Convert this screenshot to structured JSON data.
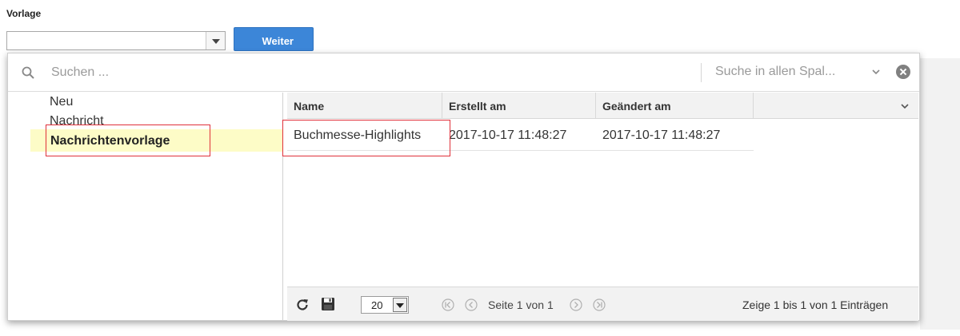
{
  "template": {
    "label": "Vorlage",
    "selected_value": "",
    "next_button": "Weiter"
  },
  "search": {
    "placeholder": "Suchen ...",
    "scope": "Suche in allen Spal..."
  },
  "tree": {
    "items": [
      {
        "label": "Neu"
      },
      {
        "label": "Nachricht"
      },
      {
        "label": "Nachrichtenvorlage",
        "selected": true
      }
    ]
  },
  "grid": {
    "columns": [
      "Name",
      "Erstellt am",
      "Geändert am"
    ],
    "rows": [
      {
        "name": "Buchmesse-Highlights",
        "created": "2017-10-17 11:48:27",
        "changed": "2017-10-17 11:48:27"
      }
    ]
  },
  "pager": {
    "page_size": "20",
    "page_text": "Seite 1 von 1",
    "summary": "Zeige 1 bis 1 von 1 Einträgen"
  },
  "colors": {
    "accent": "#3c86d8",
    "selection": "#fdfcc7",
    "highlight_box": "#e0303a"
  },
  "icons": [
    "search-icon",
    "chevron-down-icon",
    "clear-icon",
    "refresh-icon",
    "save-icon",
    "first-page-icon",
    "prev-page-icon",
    "next-page-icon",
    "last-page-icon"
  ]
}
